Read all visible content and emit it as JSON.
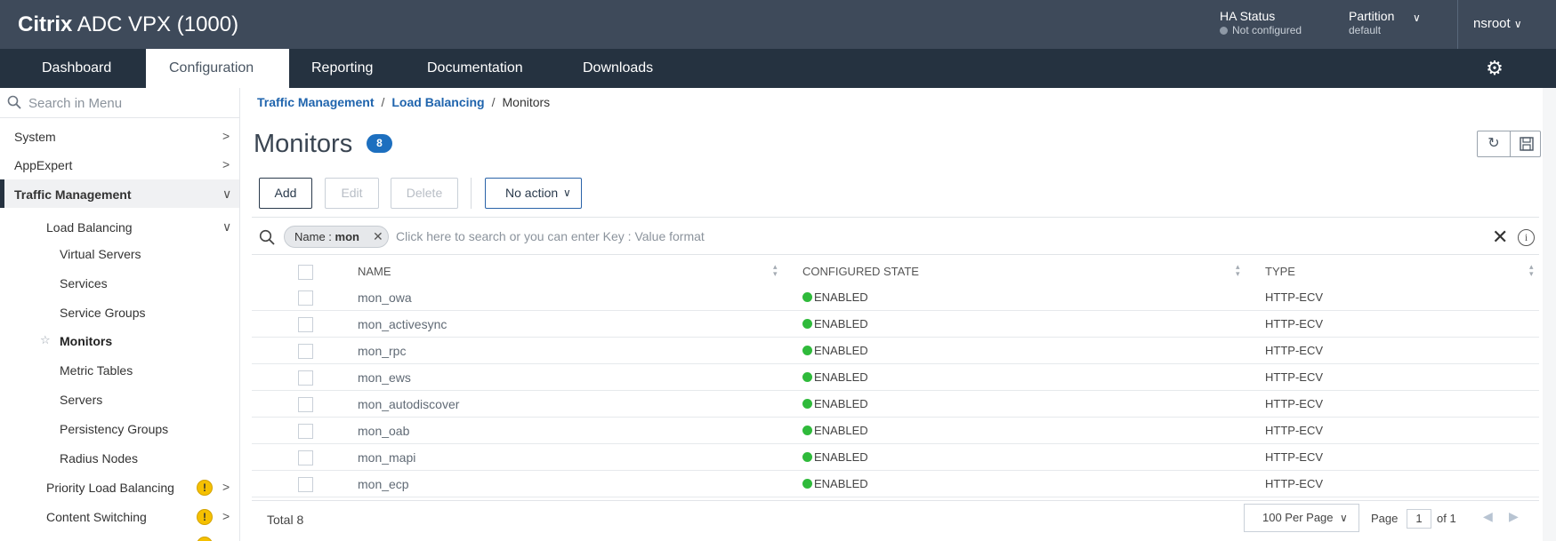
{
  "header": {
    "brand_bold": "Citrix",
    "brand_rest": " ADC VPX (1000)",
    "ha_status_label": "HA Status",
    "ha_status_value": "Not configured",
    "partition_label": "Partition",
    "partition_value": "default",
    "user": "nsroot"
  },
  "nav": {
    "tabs": [
      {
        "label": "Dashboard"
      },
      {
        "label": "Configuration"
      },
      {
        "label": "Reporting"
      },
      {
        "label": "Documentation"
      },
      {
        "label": "Downloads"
      }
    ],
    "active_tab": "Configuration"
  },
  "sidebar": {
    "search_placeholder": "Search in Menu",
    "items": [
      {
        "label": "System"
      },
      {
        "label": "AppExpert"
      },
      {
        "label": "Traffic Management"
      },
      {
        "label": "Load Balancing"
      },
      {
        "label": "Virtual Servers"
      },
      {
        "label": "Services"
      },
      {
        "label": "Service Groups"
      },
      {
        "label": "Monitors"
      },
      {
        "label": "Metric Tables"
      },
      {
        "label": "Servers"
      },
      {
        "label": "Persistency Groups"
      },
      {
        "label": "Radius Nodes"
      },
      {
        "label": "Priority Load Balancing"
      },
      {
        "label": "Content Switching"
      }
    ]
  },
  "breadcrumb": {
    "items": [
      "Traffic Management",
      "Load Balancing",
      "Monitors"
    ],
    "separator": "/"
  },
  "page": {
    "title": "Monitors",
    "count": "8"
  },
  "toolbar": {
    "add": "Add",
    "edit": "Edit",
    "delete": "Delete",
    "action": "No action"
  },
  "filter": {
    "chip_key": "Name",
    "chip_sep": " : ",
    "chip_value": "mon",
    "hint": "Click here to search or you can enter Key : Value format"
  },
  "table": {
    "columns": [
      "NAME",
      "CONFIGURED STATE",
      "TYPE"
    ],
    "rows": [
      {
        "name": "mon_owa",
        "state": "ENABLED",
        "type": "HTTP-ECV"
      },
      {
        "name": "mon_activesync",
        "state": "ENABLED",
        "type": "HTTP-ECV"
      },
      {
        "name": "mon_rpc",
        "state": "ENABLED",
        "type": "HTTP-ECV"
      },
      {
        "name": "mon_ews",
        "state": "ENABLED",
        "type": "HTTP-ECV"
      },
      {
        "name": "mon_autodiscover",
        "state": "ENABLED",
        "type": "HTTP-ECV"
      },
      {
        "name": "mon_oab",
        "state": "ENABLED",
        "type": "HTTP-ECV"
      },
      {
        "name": "mon_mapi",
        "state": "ENABLED",
        "type": "HTTP-ECV"
      },
      {
        "name": "mon_ecp",
        "state": "ENABLED",
        "type": "HTTP-ECV"
      }
    ]
  },
  "footer": {
    "total_label": "Total",
    "total_value": "8",
    "per_page": "100 Per Page",
    "page_label": "Page",
    "page_value": "1",
    "page_of": "of 1"
  },
  "colors": {
    "header_bg": "#3e4a5a",
    "nav_bg": "#253240",
    "link": "#1f64ad",
    "badge": "#1d6fbf",
    "enabled": "#2fba3b",
    "warning": "#f5c000"
  }
}
